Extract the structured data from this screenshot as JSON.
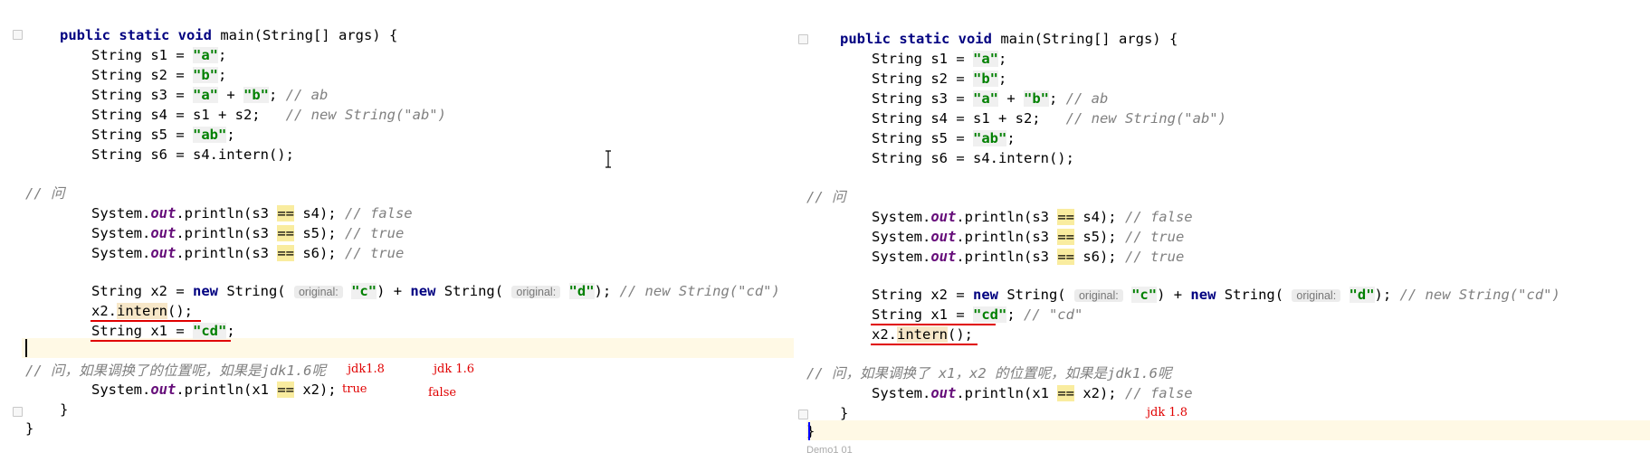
{
  "left": {
    "code_lines": [
      "public static void main(String[] args) {",
      "String s1 = \"a\";",
      "String s2 = \"b\";",
      "String s3 = \"a\" + \"b\"; // ab",
      "String s4 = s1 + s2;   // new String(\"ab\")",
      "String s5 = \"ab\";",
      "String s6 = s4.intern();",
      "// 问",
      "System.out.println(s3 == s4); // false",
      "System.out.println(s3 == s5); // true",
      "System.out.println(s3 == s6); // true",
      "String x2 = new String( original: \"c\") + new String( original: \"d\"); // new String(\"cd\")",
      "x2.intern();",
      "String x1 = \"cd\";",
      "// 问，如果调换了的位置呢，如果是jdk1.6呢",
      "System.out.println(x1 == x2);",
      "}",
      "}"
    ],
    "annotations": {
      "jdk18": "jdk1.8",
      "jdk16": "jdk 1.6",
      "true": "true",
      "false": "false"
    }
  },
  "right": {
    "code_lines": [
      "public static void main(String[] args) {",
      "String s1 = \"a\";",
      "String s2 = \"b\";",
      "String s3 = \"a\" + \"b\"; // ab",
      "String s4 = s1 + s2;   // new String(\"ab\")",
      "String s5 = \"ab\";",
      "String s6 = s4.intern();",
      "// 问",
      "System.out.println(s3 == s4); // false",
      "System.out.println(s3 == s5); // true",
      "System.out.println(s3 == s6); // true",
      "String x2 = new String( original: \"c\") + new String( original: \"d\"); // new String(\"cd\")",
      "String x1 = \"cd\"; // \"cd\"",
      "x2.intern();",
      "// 问，如果调换了 x1，x2 的位置呢，如果是jdk1.6呢",
      "System.out.println(x1 == x2); // false",
      "}",
      "}"
    ],
    "annotations": {
      "jdk18": "jdk 1.8"
    },
    "status_text": "Demo1 01"
  }
}
